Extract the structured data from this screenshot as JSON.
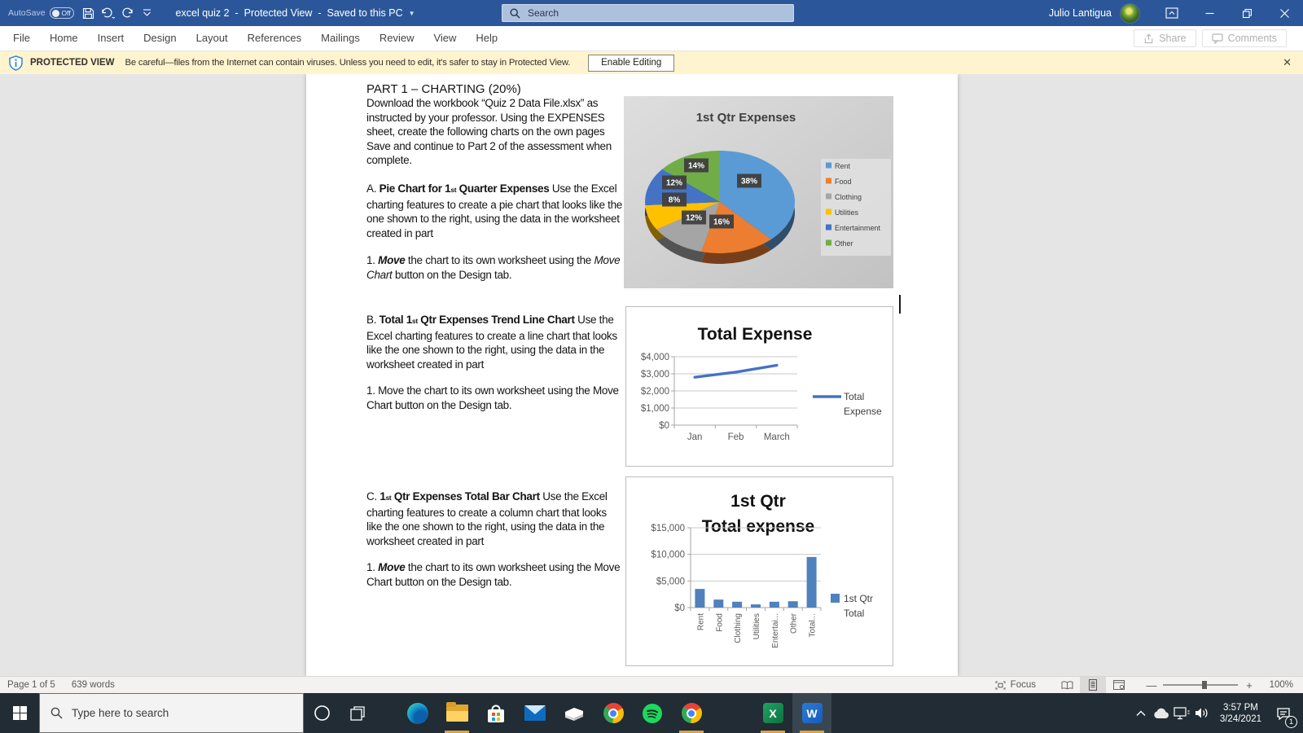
{
  "titlebar": {
    "autosave_label": "AutoSave",
    "autosave_state": "Off",
    "doc_title": "excel quiz 2  -  Protected View  -  Saved to this PC",
    "search_placeholder": "Search",
    "user_name": "Julio Lantigua"
  },
  "ribbon": {
    "tabs": [
      "File",
      "Home",
      "Insert",
      "Design",
      "Layout",
      "References",
      "Mailings",
      "Review",
      "View",
      "Help"
    ],
    "share": "Share",
    "comments": "Comments"
  },
  "banner": {
    "label": "PROTECTED VIEW",
    "message": "Be careful—files from the Internet can contain viruses. Unless you need to edit, it's safer to stay in Protected View.",
    "button": "Enable Editing"
  },
  "doc": {
    "heading": "PART 1 – CHARTING (20%)",
    "paragraphs": [
      {
        "segs": [
          {
            "t": "Download the workbook “Quiz 2 Data File.xlsx” as instructed by your professor. Using the EXPENSES sheet, create the following charts on the own pages Save and continue to Part 2 of the assessment when complete."
          }
        ]
      },
      {
        "segs": [
          {
            "t": "A. "
          },
          {
            "t": "Pie Chart for 1",
            "b": true
          },
          {
            "t": "st",
            "b": true,
            "sub": true
          },
          {
            "t": " Quarter Expenses",
            "b": true
          },
          {
            "t": " Use the Excel charting features to create a pie chart that looks like the one shown to the right, using the data in the worksheet created in part"
          }
        ]
      },
      {
        "segs": [
          {
            "t": "1. "
          },
          {
            "t": "Move",
            "b": true,
            "i": true
          },
          {
            "t": " the chart to its own worksheet using the "
          },
          {
            "t": "Move Chart",
            "i": true
          },
          {
            "t": " button on the Design tab."
          }
        ]
      },
      {
        "segs": [
          {
            "t": "B. "
          },
          {
            "t": "Total 1",
            "b": true
          },
          {
            "t": "st",
            "b": true,
            "sub": true
          },
          {
            "t": " Qtr Expenses Trend Line Chart",
            "b": true
          },
          {
            "t": " Use the Excel charting features to create a line chart that looks like the one shown to the right, using the data in the worksheet created in part"
          }
        ]
      },
      {
        "segs": [
          {
            "t": "1. Move the chart to its own worksheet using the Move Chart button on the Design tab."
          }
        ]
      },
      {
        "segs": [
          {
            "t": "C. "
          },
          {
            "t": "1",
            "b": true
          },
          {
            "t": "st",
            "b": true,
            "sub": true
          },
          {
            "t": " Qtr Expenses Total Bar Chart",
            "b": true
          },
          {
            "t": " Use the Excel charting features to create a column chart that looks like the one shown to the right, using the data in the worksheet created in part"
          }
        ]
      },
      {
        "segs": [
          {
            "t": "1. "
          },
          {
            "t": "Move",
            "b": true,
            "i": true
          },
          {
            "t": " the chart to its own worksheet using the Move Chart button on the Design tab."
          }
        ]
      }
    ]
  },
  "chart_data": [
    {
      "type": "pie",
      "title": "1st Qtr Expenses",
      "labels": [
        "Rent",
        "Food",
        "Clothing",
        "Utilities",
        "Entertainment",
        "Other"
      ],
      "values": [
        38,
        16,
        12,
        8,
        12,
        14
      ],
      "value_labels": [
        "38%",
        "16%",
        "12%",
        "8%",
        "12%",
        "14%"
      ],
      "colors": [
        "#5b9bd5",
        "#ed7d31",
        "#a5a5a5",
        "#ffc000",
        "#4472c4",
        "#70ad47"
      ],
      "style": "3d",
      "legend_position": "right"
    },
    {
      "type": "line",
      "title": "Total Expense",
      "x": [
        "Jan",
        "Feb",
        "March"
      ],
      "series": [
        {
          "name": "Total Expense",
          "values": [
            2800,
            3100,
            3500
          ],
          "color": "#4472c4"
        }
      ],
      "ylim": [
        0,
        4000
      ],
      "yticks": [
        "$0",
        "$1,000",
        "$2,000",
        "$3,000",
        "$4,000"
      ],
      "grid": true,
      "legend_position": "right",
      "legend_lines": [
        "Total",
        "Expense"
      ]
    },
    {
      "type": "bar",
      "title_lines": [
        "1st Qtr",
        "Total expense"
      ],
      "categories": [
        "Rent",
        "Food",
        "Clothing",
        "Utilities",
        "Entertai...",
        "Other",
        "Total..."
      ],
      "series": [
        {
          "name": "1st Qtr Total",
          "values": [
            3500,
            1500,
            1100,
            600,
            1100,
            1200,
            9500
          ],
          "color": "#4f81bd"
        }
      ],
      "ylim": [
        0,
        15000
      ],
      "yticks": [
        "$0",
        "$5,000",
        "$10,000",
        "$15,000"
      ],
      "grid": true,
      "legend_position": "right",
      "legend_lines": [
        "1st Qtr",
        "Total"
      ]
    }
  ],
  "statusbar": {
    "page": "Page 1 of 5",
    "words": "639 words",
    "focus": "Focus",
    "zoom": "100%"
  },
  "taskbar": {
    "search_placeholder": "Type here to search",
    "time": "3:57 PM",
    "date": "3/24/2021",
    "badge": "1",
    "apps": [
      {
        "name": "edge",
        "running": false
      },
      {
        "name": "file-explorer",
        "running": true
      },
      {
        "name": "store",
        "running": false
      },
      {
        "name": "mail",
        "running": false
      },
      {
        "name": "book-app",
        "running": false
      },
      {
        "name": "chrome",
        "running": false
      },
      {
        "name": "spotify",
        "running": false
      },
      {
        "name": "chrome-2",
        "icon": "chrome",
        "running": true
      },
      {
        "name": "excel",
        "running": true,
        "gap_before": true
      },
      {
        "name": "word",
        "running": true,
        "active": true
      }
    ]
  }
}
